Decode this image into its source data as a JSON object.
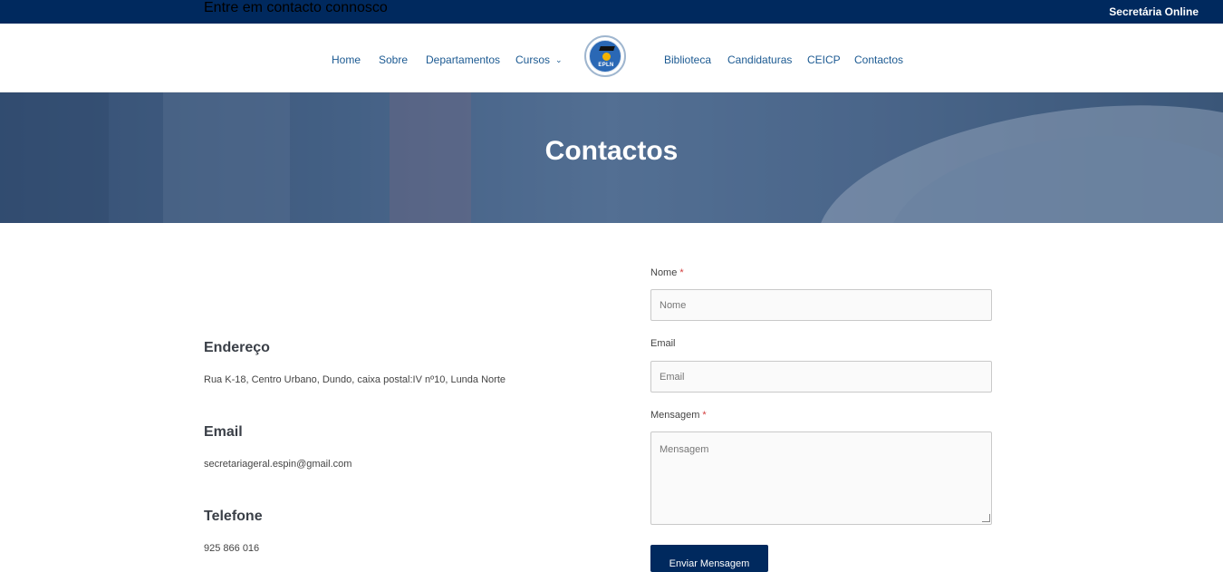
{
  "topbar": {
    "online_link": "Secretária Online"
  },
  "nav": {
    "left_items": [
      {
        "label": "Home"
      },
      {
        "label": "Sobre"
      },
      {
        "label": "Departamentos"
      },
      {
        "label": "Cursos"
      }
    ],
    "logo_text": "EPLN",
    "right_items": [
      {
        "label": "Biblioteca"
      },
      {
        "label": "Candidaturas"
      },
      {
        "label": "CEICP"
      },
      {
        "label": "Contactos"
      }
    ]
  },
  "hero": {
    "title": "Contactos"
  },
  "contact": {
    "intro": "Entre em contacto connosco",
    "address_heading": "Endereço",
    "address": "Rua K-18, Centro Urbano, Dundo, caixa postal:IV nº10, Lunda Norte",
    "email_heading": "Email",
    "email": "secretariageral.espin@gmail.com",
    "phone_heading": "Telefone",
    "phone": "925 866 016"
  },
  "form": {
    "name_label": "Nome",
    "name_required": "*",
    "name_placeholder": "Nome",
    "email_label": "Email",
    "email_placeholder": "Email",
    "message_label": "Mensagem",
    "message_required": "*",
    "message_placeholder": "Mensagem",
    "submit_label": "Enviar Mensagem"
  },
  "colors": {
    "primary": "#00295e",
    "link": "#1c5a92",
    "required": "#d33c3c"
  }
}
